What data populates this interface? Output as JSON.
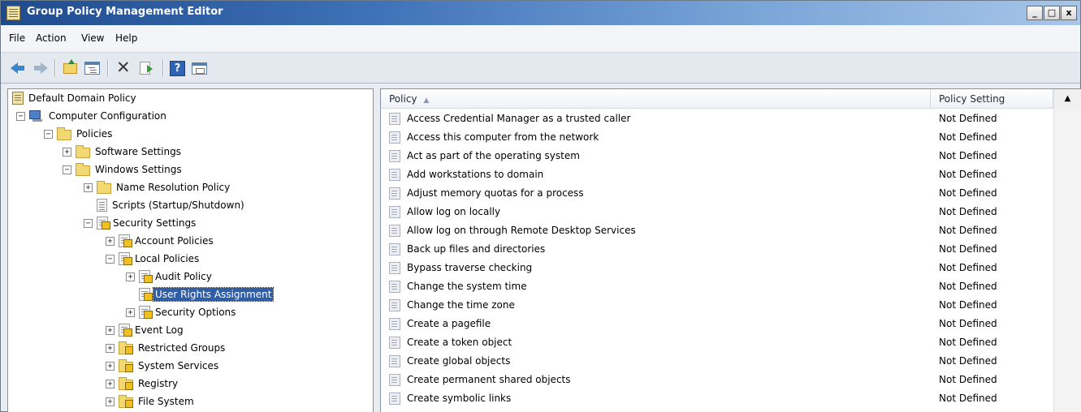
{
  "window": {
    "title": "Group Policy Management Editor",
    "controls": [
      "_",
      "□",
      "x"
    ]
  },
  "menu": [
    "File",
    "Action",
    "View",
    "Help"
  ],
  "toolbar": {
    "buttons": [
      "back-arrow-icon",
      "forward-arrow-icon",
      "up-one-level-icon",
      "show-hide-console-tree-icon",
      "delete-icon",
      "export-list-icon",
      "help-icon",
      "properties-icon"
    ]
  },
  "tree": {
    "root": "Default Domain Policy",
    "computer_configuration": "Computer Configuration",
    "policies": "Policies",
    "software_settings": "Software Settings",
    "windows_settings": "Windows Settings",
    "name_resolution_policy": "Name Resolution Policy",
    "scripts": "Scripts (Startup/Shutdown)",
    "security_settings": "Security Settings",
    "account_policies": "Account Policies",
    "local_policies": "Local Policies",
    "audit_policy": "Audit Policy",
    "user_rights_assignment": "User Rights Assignment",
    "security_options": "Security Options",
    "event_log": "Event Log",
    "restricted_groups": "Restricted Groups",
    "system_services": "System Services",
    "registry": "Registry",
    "file_system": "File System",
    "expand_glyph": "+",
    "collapse_glyph": "−"
  },
  "list": {
    "columns": [
      "Policy",
      "Policy Setting"
    ],
    "sort_indicator": "▲",
    "scroll_up": "▲",
    "rows": [
      {
        "policy": "Access Credential Manager as a trusted caller",
        "setting": "Not Defined"
      },
      {
        "policy": "Access this computer from the network",
        "setting": "Not Defined"
      },
      {
        "policy": "Act as part of the operating system",
        "setting": "Not Defined"
      },
      {
        "policy": "Add workstations to domain",
        "setting": "Not Defined"
      },
      {
        "policy": "Adjust memory quotas for a process",
        "setting": "Not Defined"
      },
      {
        "policy": "Allow log on locally",
        "setting": "Not Defined"
      },
      {
        "policy": "Allow log on through Remote Desktop Services",
        "setting": "Not Defined"
      },
      {
        "policy": "Back up files and directories",
        "setting": "Not Defined"
      },
      {
        "policy": "Bypass traverse checking",
        "setting": "Not Defined"
      },
      {
        "policy": "Change the system time",
        "setting": "Not Defined"
      },
      {
        "policy": "Change the time zone",
        "setting": "Not Defined"
      },
      {
        "policy": "Create a pagefile",
        "setting": "Not Defined"
      },
      {
        "policy": "Create a token object",
        "setting": "Not Defined"
      },
      {
        "policy": "Create global objects",
        "setting": "Not Defined"
      },
      {
        "policy": "Create permanent shared objects",
        "setting": "Not Defined"
      },
      {
        "policy": "Create symbolic links",
        "setting": "Not Defined"
      }
    ]
  }
}
